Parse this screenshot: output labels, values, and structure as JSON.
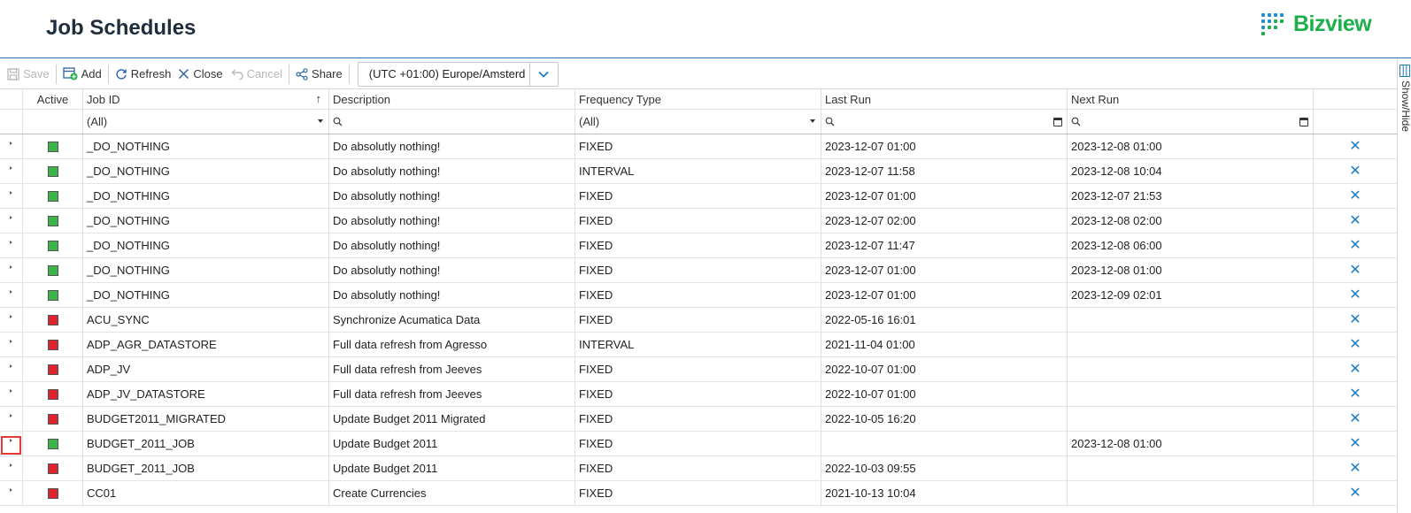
{
  "header": {
    "title": "Job Schedules",
    "brand": "Bizview",
    "brand_color": "#1db04a"
  },
  "toolbar": {
    "save": "Save",
    "add": "Add",
    "refresh": "Refresh",
    "close": "Close",
    "cancel": "Cancel",
    "share": "Share",
    "timezone": "(UTC +01:00) Europe/Amsterd"
  },
  "side_panel": {
    "label": "Show/Hide"
  },
  "columns": {
    "active": "Active",
    "job_id": "Job ID",
    "description": "Description",
    "frequency_type": "Frequency Type",
    "last_run": "Last Run",
    "next_run": "Next Run"
  },
  "filters": {
    "job_id": "(All)",
    "frequency_type": "(All)",
    "search_icon": "search-icon",
    "calendar_icon": "calendar-icon"
  },
  "status_colors": {
    "active": "#3bb54a",
    "inactive": "#e0242b"
  },
  "rows": [
    {
      "active": true,
      "job_id": "_DO_NOTHING",
      "description": "Do absolutly nothing!",
      "frequency": "FIXED",
      "last_run": "2023-12-07 01:00",
      "next_run": "2023-12-08 01:00"
    },
    {
      "active": true,
      "job_id": "_DO_NOTHING",
      "description": "Do absolutly nothing!",
      "frequency": "INTERVAL",
      "last_run": "2023-12-07 11:58",
      "next_run": "2023-12-08 10:04"
    },
    {
      "active": true,
      "job_id": "_DO_NOTHING",
      "description": "Do absolutly nothing!",
      "frequency": "FIXED",
      "last_run": "2023-12-07 01:00",
      "next_run": "2023-12-07 21:53"
    },
    {
      "active": true,
      "job_id": "_DO_NOTHING",
      "description": "Do absolutly nothing!",
      "frequency": "FIXED",
      "last_run": "2023-12-07 02:00",
      "next_run": "2023-12-08 02:00"
    },
    {
      "active": true,
      "job_id": "_DO_NOTHING",
      "description": "Do absolutly nothing!",
      "frequency": "FIXED",
      "last_run": "2023-12-07 11:47",
      "next_run": "2023-12-08 06:00"
    },
    {
      "active": true,
      "job_id": "_DO_NOTHING",
      "description": "Do absolutly nothing!",
      "frequency": "FIXED",
      "last_run": "2023-12-07 01:00",
      "next_run": "2023-12-08 01:00"
    },
    {
      "active": true,
      "job_id": "_DO_NOTHING",
      "description": "Do absolutly nothing!",
      "frequency": "FIXED",
      "last_run": "2023-12-07 01:00",
      "next_run": "2023-12-09 02:01"
    },
    {
      "active": false,
      "job_id": "ACU_SYNC",
      "description": "Synchronize Acumatica Data",
      "frequency": "FIXED",
      "last_run": "2022-05-16 16:01",
      "next_run": ""
    },
    {
      "active": false,
      "job_id": "ADP_AGR_DATASTORE",
      "description": "Full data refresh from Agresso",
      "frequency": "INTERVAL",
      "last_run": "2021-11-04 01:00",
      "next_run": ""
    },
    {
      "active": false,
      "job_id": "ADP_JV",
      "description": "Full data refresh from Jeeves",
      "frequency": "FIXED",
      "last_run": "2022-10-07 01:00",
      "next_run": ""
    },
    {
      "active": false,
      "job_id": "ADP_JV_DATASTORE",
      "description": "Full data refresh from Jeeves",
      "frequency": "FIXED",
      "last_run": "2022-10-07 01:00",
      "next_run": ""
    },
    {
      "active": false,
      "job_id": "BUDGET2011_MIGRATED",
      "description": "Update Budget 2011 Migrated",
      "frequency": "FIXED",
      "last_run": "2022-10-05 16:20",
      "next_run": ""
    },
    {
      "active": true,
      "job_id": "BUDGET_2011_JOB",
      "description": "Update Budget 2011",
      "frequency": "FIXED",
      "last_run": "",
      "next_run": "2023-12-08 01:00",
      "highlighted": true
    },
    {
      "active": false,
      "job_id": "BUDGET_2011_JOB",
      "description": "Update Budget 2011",
      "frequency": "FIXED",
      "last_run": "2022-10-03 09:55",
      "next_run": ""
    },
    {
      "active": false,
      "job_id": "CC01",
      "description": "Create Currencies",
      "frequency": "FIXED",
      "last_run": "2021-10-13 10:04",
      "next_run": ""
    }
  ]
}
